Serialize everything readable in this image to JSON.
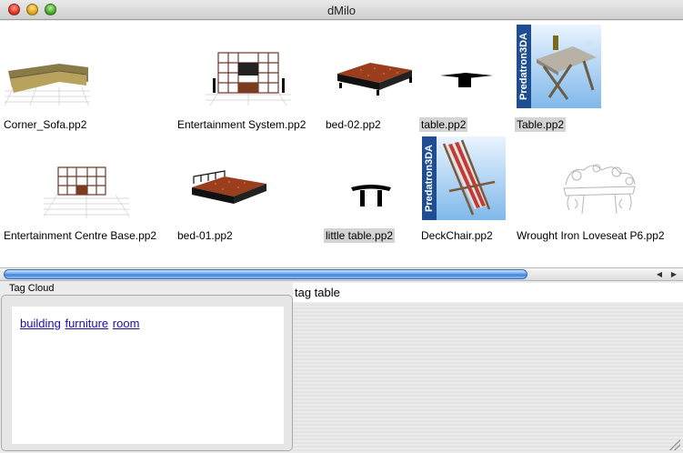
{
  "window": {
    "title": "dMilo"
  },
  "items": [
    {
      "name": "Corner_Sofa.pp2",
      "selected": false,
      "thumb": "corner-sofa"
    },
    {
      "name": "Entertainment System.pp2",
      "selected": false,
      "thumb": "entertainment-system"
    },
    {
      "name": "bed-02.pp2",
      "selected": false,
      "thumb": "bed"
    },
    {
      "name": "table.pp2",
      "selected": true,
      "thumb": "table"
    },
    {
      "name": "Table.pp2",
      "selected": true,
      "thumb": "predatron-table"
    },
    {
      "name": "Entertainment Centre Base.pp2",
      "selected": false,
      "thumb": "entertainment-base"
    },
    {
      "name": "bed-01.pp2",
      "selected": false,
      "thumb": "bed"
    },
    {
      "name": "little table.pp2",
      "selected": true,
      "thumb": "little-table"
    },
    {
      "name": "DeckChair.pp2",
      "selected": false,
      "thumb": "predatron-deckchair"
    },
    {
      "name": "Wrought Iron Loveseat P6.pp2",
      "selected": false,
      "thumb": "loveseat"
    }
  ],
  "predatron_label": "Predatron3DA",
  "tag_cloud": {
    "label": "Tag Cloud",
    "tags": [
      "building",
      "furniture",
      "room"
    ]
  },
  "query": {
    "text": "tag table"
  },
  "colors": {
    "selection": "#d4d4d4",
    "link": "#1a0dab",
    "scroll_thumb": "#3c7fd8"
  }
}
